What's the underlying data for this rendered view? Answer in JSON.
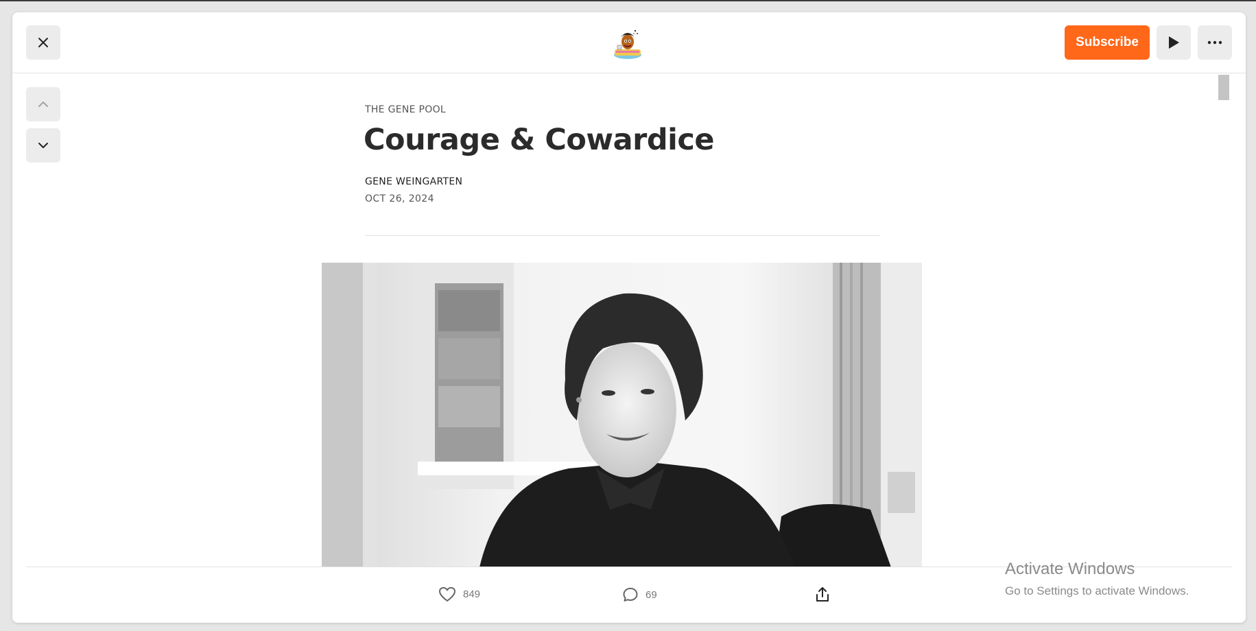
{
  "header": {
    "close_label": "Close",
    "logo_alt": "The Gene Pool logo",
    "subscribe_label": "Subscribe",
    "play_label": "Play",
    "more_label": "More"
  },
  "article": {
    "publication": "THE GENE POOL",
    "title": "Courage & Cowardice",
    "author": "GENE WEINGARTEN",
    "date": "OCT 26, 2024"
  },
  "footer": {
    "likes": "849",
    "comments": "69"
  },
  "watermark": {
    "title": "Activate Windows",
    "subtitle": "Go to Settings to activate Windows."
  },
  "colors": {
    "accent": "#ff6719",
    "title_text": "#2b2b2b",
    "button_bg": "#ececec"
  },
  "icons": [
    "close-icon",
    "play-icon",
    "more-icon",
    "chevron-up-icon",
    "chevron-down-icon",
    "heart-icon",
    "comment-icon",
    "share-icon"
  ]
}
